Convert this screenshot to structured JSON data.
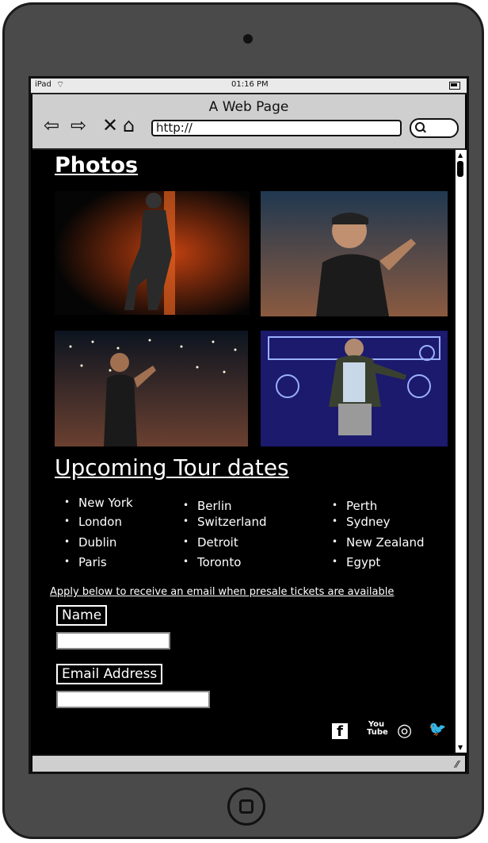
{
  "status": {
    "device": "iPad",
    "time": "01:16 PM"
  },
  "browser": {
    "title": "A Web Page",
    "url": "http://"
  },
  "photos": {
    "heading": "Photos"
  },
  "tour": {
    "heading": "Upcoming Tour dates",
    "col1": [
      "New York",
      "London",
      "Dublin",
      "Paris"
    ],
    "col2": [
      "Berlin",
      "Switzerland",
      "Detroit",
      "Toronto"
    ],
    "col3": [
      "Perth",
      "Sydney",
      "New Zealand",
      "Egypt"
    ]
  },
  "form": {
    "presale_text": "Apply below to receive an email when presale tickets are available",
    "name_label": "Name",
    "email_label": "Email Address"
  },
  "social": {
    "facebook": "f",
    "youtube": "You Tube",
    "instagram": "◎",
    "twitter": "🐦"
  }
}
